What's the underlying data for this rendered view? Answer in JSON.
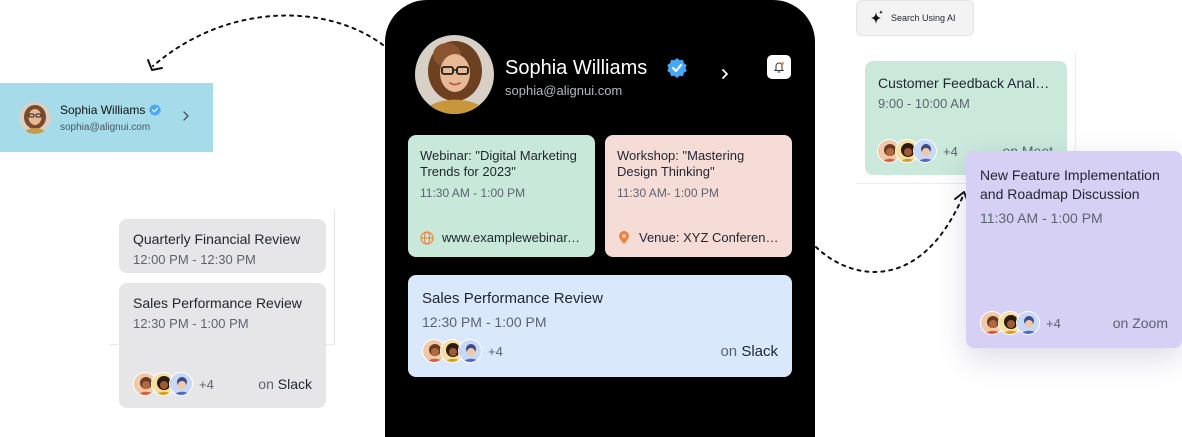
{
  "mini_profile": {
    "name": "Sophia Williams",
    "email": "sophia@alignui.com"
  },
  "phone_profile": {
    "name": "Sophia Williams",
    "email": "sophia@alignui.com"
  },
  "left_events": [
    {
      "title": "Quarterly Financial Review",
      "time": "12:00 PM - 12:30 PM"
    },
    {
      "title": "Sales Performance Review",
      "time": "12:30 PM - 1:00 PM",
      "extra_count": "+4",
      "platform_prefix": "on",
      "platform": "Slack"
    }
  ],
  "phone_events": {
    "webinar": {
      "title": "Webinar: \"Digital Marketing Trends for 2023\"",
      "time": "11:30 AM - 1:00 PM",
      "link": "www.examplewebinar.com",
      "icon": "globe-icon"
    },
    "workshop": {
      "title": "Workshop: \"Mastering Design Thinking\"",
      "time": "11:30 AM- 1:00 PM",
      "venue": "Venue: XYZ Conference Center",
      "icon": "location-pin-icon"
    },
    "sales": {
      "title": "Sales Performance Review",
      "time": "12:30 PM - 1:00 PM",
      "extra_count": "+4",
      "platform_prefix": "on",
      "platform": "Slack"
    }
  },
  "search_ai": {
    "label": "Search Using AI",
    "icon": "sparkle-icon"
  },
  "right_events": {
    "customer_feedback": {
      "title": "Customer Feedback Analysis",
      "time": "9:00 - 10:00 AM",
      "extra_count": "+4",
      "platform": "on Meet"
    },
    "new_feature": {
      "title": "New Feature Implementation and Roadmap Discussion",
      "time": "11:30 AM - 1:00 PM",
      "extra_count": "+4",
      "platform": "on Zoom"
    }
  },
  "colors": {
    "phone_bg": "#000000",
    "verified_blue": "#47a8f5",
    "webinar_card": "#c8e8da",
    "workshop_card": "#f6dcd6",
    "sales_card": "#d9e8fa",
    "zoom_card": "#d6d0f5",
    "mini_profile_bg": "#a6dcea",
    "accent_orange": "#f0823c"
  }
}
